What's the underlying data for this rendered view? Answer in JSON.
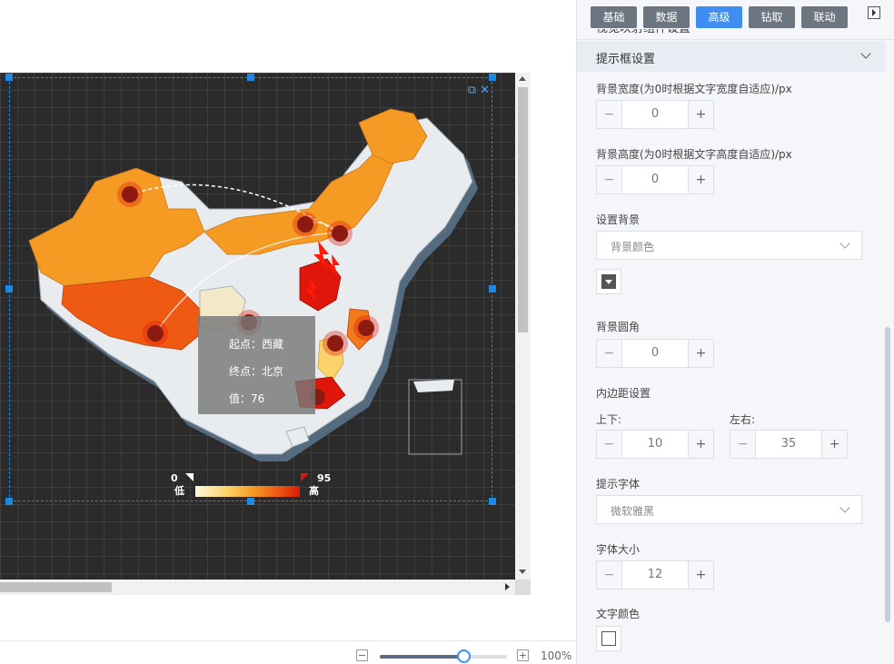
{
  "tabs": [
    {
      "label": "基础",
      "active": false
    },
    {
      "label": "数据",
      "active": false
    },
    {
      "label": "高级",
      "active": true
    },
    {
      "label": "钻取",
      "active": false
    },
    {
      "label": "联动",
      "active": false
    }
  ],
  "panel": {
    "prev_section_title": "视觉映射组件设置",
    "section_title": "提示框设置",
    "bg_width_label": "背景宽度(为0时根据文字宽度自适应)/px",
    "bg_width_value": "0",
    "bg_height_label": "背景高度(为0时根据文字高度自适应)/px",
    "bg_height_value": "0",
    "bg_setting_label": "设置背景",
    "bg_setting_value": "背景颜色",
    "bg_radius_label": "背景圆角",
    "bg_radius_value": "0",
    "padding_label": "内边距设置",
    "padding_vertical_label": "上下:",
    "padding_vertical_value": "10",
    "padding_horizontal_label": "左右:",
    "padding_horizontal_value": "35",
    "font_label": "提示字体",
    "font_value": "微软雅黑",
    "font_size_label": "字体大小",
    "font_size_value": "12",
    "text_color_label": "文字颜色",
    "minus": "−",
    "plus": "+"
  },
  "tooltip": {
    "start": "起点：西藏",
    "end": "终点：北京",
    "value": "值：76"
  },
  "legend": {
    "min": "0",
    "max": "95",
    "low_label": "低",
    "high_label": "高"
  },
  "zoom": {
    "level": "100%",
    "fraction": 0.66,
    "minus": "−",
    "plus": "+"
  },
  "colors": {
    "accent": "#3d8ef0",
    "tab_inactive": "#6d7580",
    "map_low": "#fff7dc",
    "map_mid": "#f49b22",
    "map_high": "#d81c0a",
    "bg_color_swatch": "#555555",
    "text_color_swatch": "#ffffff"
  }
}
